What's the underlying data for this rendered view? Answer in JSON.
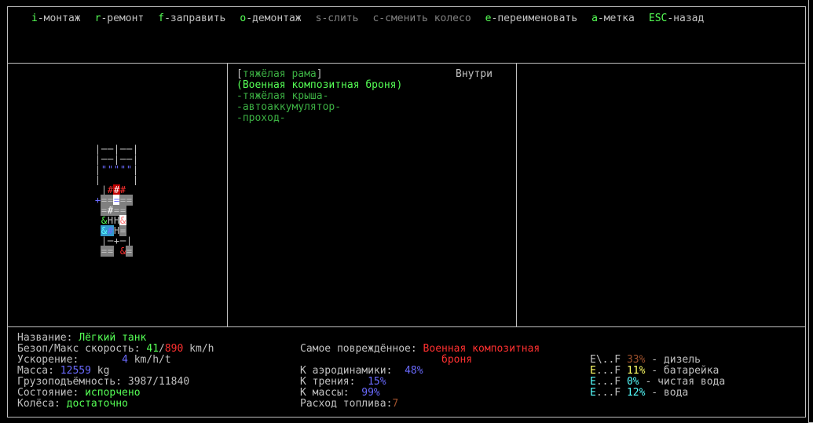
{
  "menu": [
    {
      "key": "i",
      "label": "-монтаж",
      "enabled": true
    },
    {
      "key": "r",
      "label": "-ремонт",
      "enabled": true
    },
    {
      "key": "f",
      "label": "-заправить",
      "enabled": true
    },
    {
      "key": "o",
      "label": "-демонтаж",
      "enabled": true
    },
    {
      "key": "s",
      "label": "-слить",
      "enabled": false
    },
    {
      "key": "c",
      "label": "-сменить колесо",
      "enabled": false
    },
    {
      "key": "e",
      "label": "-переименовать",
      "enabled": true
    },
    {
      "key": "a",
      "label": "-метка",
      "enabled": true
    },
    {
      "key": "ESC",
      "label": "-назад",
      "enabled": true
    }
  ],
  "parts_panel": {
    "location": "Внутри",
    "parts": [
      {
        "text": "[тяжёлая рама]",
        "style": "frame"
      },
      {
        "text": "(Военная композитная броня)",
        "style": "selected"
      },
      {
        "text": "-тяжёлая крыша-",
        "style": "normal"
      },
      {
        "text": "-автоаккумулятор-",
        "style": "normal"
      },
      {
        "text": "-проход-",
        "style": "normal"
      }
    ]
  },
  "vehicle": {
    "name_label": "Название: ",
    "name_value": "Лёгкий танк",
    "speed_label": "Безоп/Макс скорость: ",
    "speed_safe": "41",
    "speed_sep": "/",
    "speed_max": "890",
    "speed_unit": " km/h",
    "accel_label": "Ускорение:       ",
    "accel_value": "4",
    "accel_unit": " km/h/t",
    "mass_label": "Масса: ",
    "mass_value": "12559",
    "mass_unit": " kg",
    "cargo_label": "Грузоподъёмность: ",
    "cargo_value": "3987/11840",
    "status_label": "Состояние: ",
    "status_value": "испорчено",
    "wheels_label": "Колёса: ",
    "wheels_value": "достаточно"
  },
  "stats": {
    "damaged_label": "Самое повреждённое: ",
    "damaged_value_1": "Военная композитная",
    "damaged_value_2": "броня",
    "aero_label": "К аэродинамики:  ",
    "aero_value": "48%",
    "friction_label": "К трения:  ",
    "friction_value": "15%",
    "massk_label": "К массы:  ",
    "massk_value": "99%",
    "fuel_label": "Расход топлива:",
    "fuel_value": "7"
  },
  "tanks": [
    {
      "e": "E",
      "gauge": "\\..F",
      "pct": "33%",
      "name": " - дизель",
      "color": "#a0522d"
    },
    {
      "e": "E",
      "gauge": "...F",
      "pct": "11%",
      "name": " - батарейка",
      "color": "#ffff66"
    },
    {
      "e": "E",
      "gauge": "...F",
      "pct": "0%",
      "name": " - чистая вода",
      "color": "#55ffff"
    },
    {
      "e": "E",
      "gauge": "...F",
      "pct": "12%",
      "name": " - вода",
      "color": "#55ffff"
    }
  ]
}
